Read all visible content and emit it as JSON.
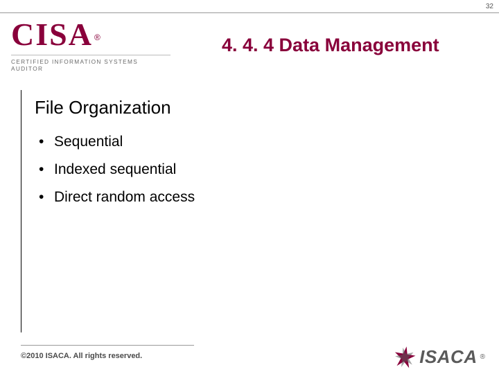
{
  "page_number": "32",
  "logo": {
    "word": "CISA",
    "registered": "®",
    "subtitle": "CERTIFIED INFORMATION SYSTEMS AUDITOR"
  },
  "title": "4. 4. 4 Data Management",
  "subhead": "File Organization",
  "bullets": [
    "Sequential",
    "Indexed sequential",
    "Direct random access"
  ],
  "footer": {
    "copyright": "©2010 ISACA.  All rights reserved.",
    "org": "ISACA",
    "org_reg": "®"
  }
}
